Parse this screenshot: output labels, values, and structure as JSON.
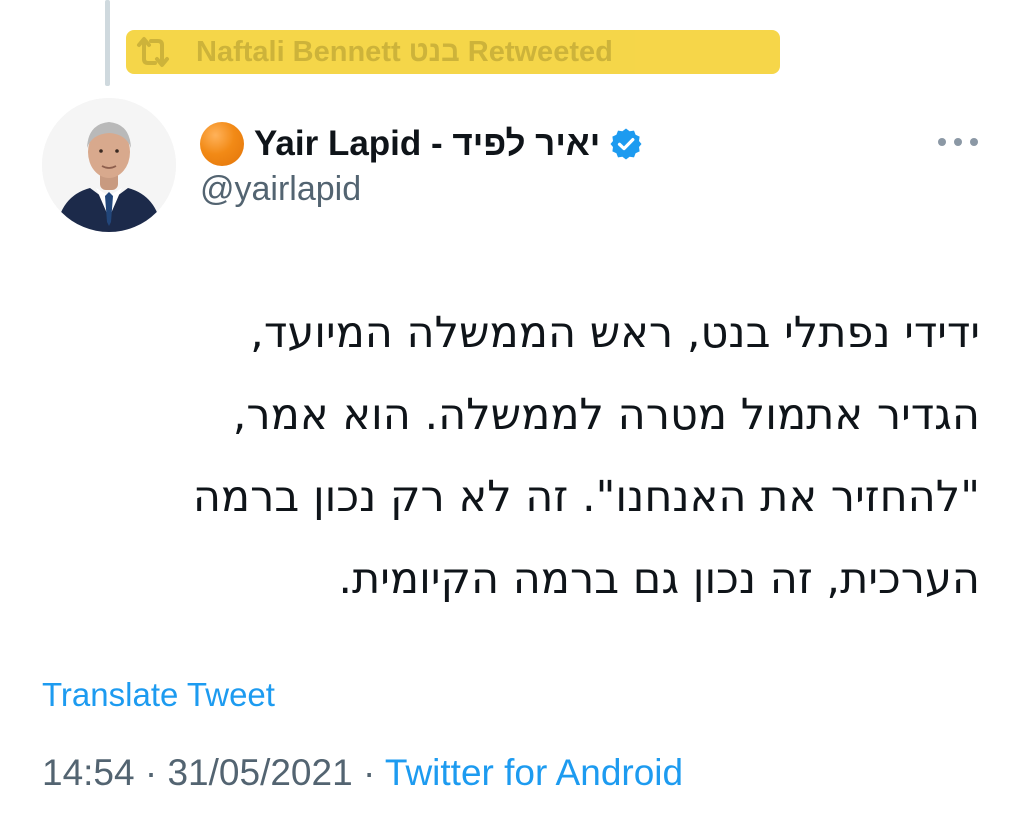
{
  "retweet": {
    "text": "Naftali Bennett בנט Retweeted",
    "icon": "retweet-icon"
  },
  "author": {
    "display_name": "Yair Lapid - יאיר לפיד",
    "handle": "@yairlapid",
    "status_emoji": "orange-circle",
    "verified": true,
    "verified_color": "#1d9bf0"
  },
  "tweet": {
    "lines": [
      "ידידי נפתלי בנט, ראש הממשלה המיועד,",
      "הגדיר אתמול מטרה לממשלה. הוא אמר,",
      "\"להחזיר את האנחנו\". זה לא רק נכון ברמה",
      "הערכית, זה נכון גם ברמה הקיומית."
    ]
  },
  "translate_label": "Translate Tweet",
  "meta": {
    "time": "14:54",
    "separator": "·",
    "date": "31/05/2021",
    "source": "Twitter for Android"
  },
  "colors": {
    "accent": "#1d9bf0",
    "highlight": "#f5d33a",
    "secondary_text": "#536471"
  }
}
